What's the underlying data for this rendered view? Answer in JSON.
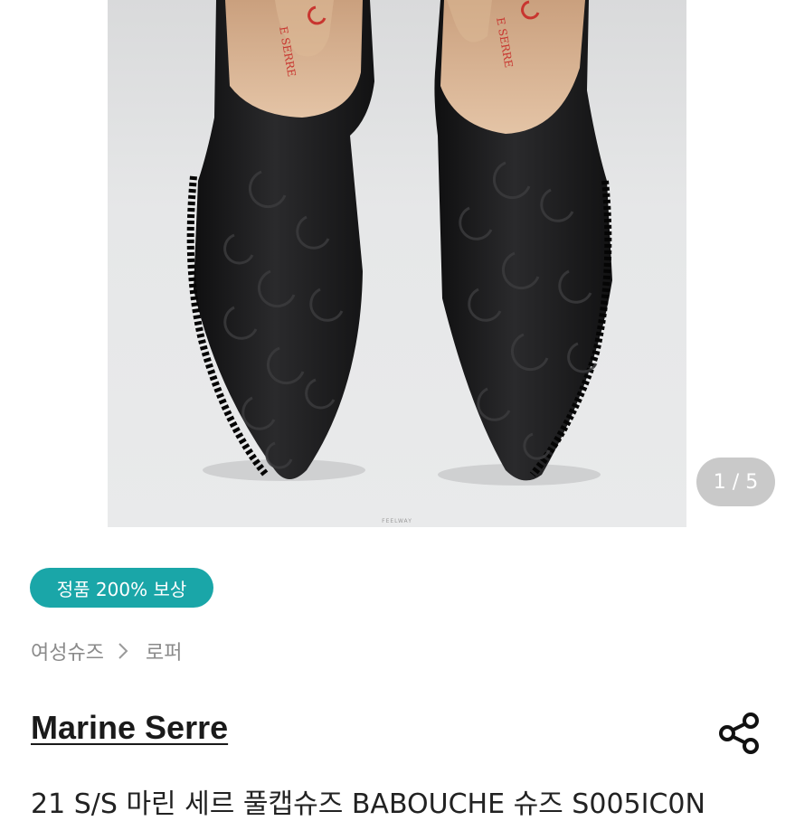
{
  "gallery": {
    "counter": "1 / 5",
    "watermark": "FEELWAY",
    "shoe_label": "E SERRE"
  },
  "badge": {
    "label": "정품 200% 보상"
  },
  "breadcrumb": {
    "items": [
      "여성슈즈",
      "로퍼"
    ]
  },
  "product": {
    "brand": "Marine Serre",
    "title": "21 S/S 마린 세르 풀캡슈즈 BABOUCHE 슈즈 S005IC0N"
  },
  "colors": {
    "badge": "#1aa6a8",
    "counter_bg": "#c9c9c9",
    "muted_text": "#8a8a8a"
  },
  "icons": {
    "share": "share-icon",
    "chevron": "chevron-right-icon"
  }
}
